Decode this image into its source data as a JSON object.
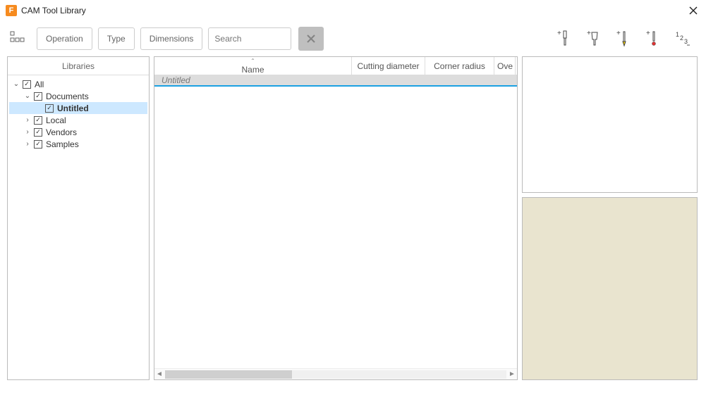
{
  "window": {
    "app_icon_letter": "F",
    "title": "CAM Tool Library"
  },
  "toolbar": {
    "filters": {
      "operation": "Operation",
      "type": "Type",
      "dimensions": "Dimensions"
    },
    "search_placeholder": "Search"
  },
  "sidebar": {
    "header": "Libraries",
    "tree": {
      "all": "All",
      "documents": "Documents",
      "untitled": "Untitled",
      "local": "Local",
      "vendors": "Vendors",
      "samples": "Samples"
    }
  },
  "grid": {
    "columns": {
      "name": "Name",
      "cutting_diameter": "Cutting diameter",
      "corner_radius": "Corner radius",
      "overall_trunc": "Ove"
    },
    "rows": [
      {
        "name": "Untitled"
      }
    ]
  }
}
